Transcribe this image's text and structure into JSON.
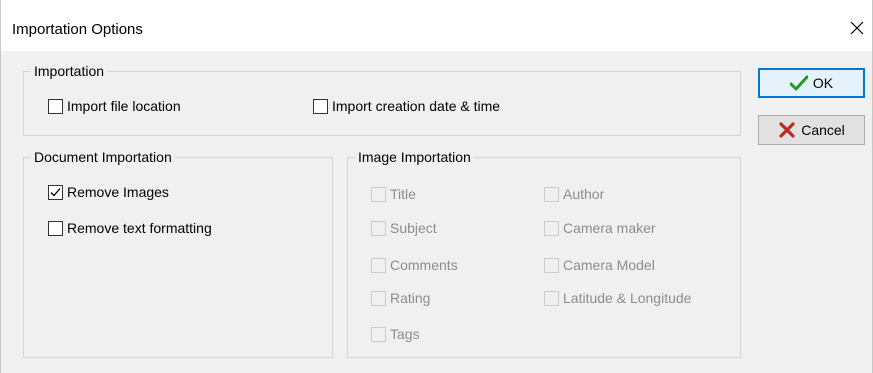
{
  "window": {
    "title": "Importation Options"
  },
  "importation": {
    "legend": "Importation",
    "import_file_location": {
      "label": "Import file location",
      "checked": false
    },
    "import_creation_date": {
      "label": "Import creation date & time",
      "checked": false
    }
  },
  "document_importation": {
    "legend": "Document Importation",
    "remove_images": {
      "label": "Remove Images",
      "checked": true
    },
    "remove_text_formatting": {
      "label": "Remove text formatting",
      "checked": false
    }
  },
  "image_importation": {
    "legend": "Image Importation",
    "items": [
      {
        "label": "Title"
      },
      {
        "label": "Subject"
      },
      {
        "label": "Comments"
      },
      {
        "label": "Rating"
      },
      {
        "label": "Tags"
      },
      {
        "label": "Author"
      },
      {
        "label": "Camera maker"
      },
      {
        "label": "Camera Model"
      },
      {
        "label": "Latitude & Longitude"
      }
    ]
  },
  "buttons": {
    "ok": "OK",
    "cancel": "Cancel"
  },
  "colors": {
    "ok_check": "#1f9a1f",
    "cancel_x": "#c0281e",
    "default_border": "#0078d7"
  }
}
